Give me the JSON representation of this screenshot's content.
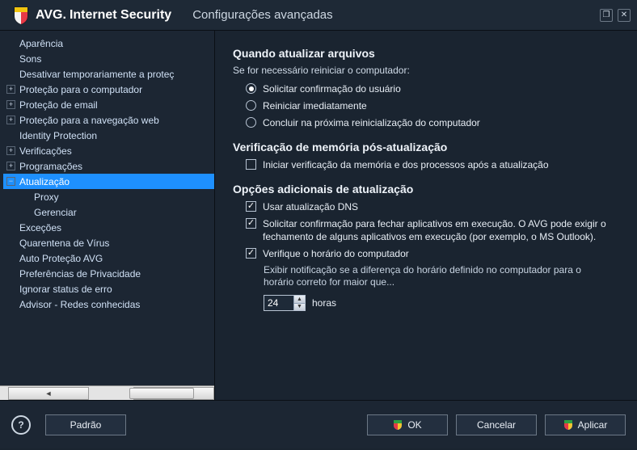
{
  "titlebar": {
    "brand_bold": "AVG.",
    "brand_product": "Internet Security",
    "subtitle": "Configurações avançadas"
  },
  "sidebar": {
    "items": [
      {
        "label": "Aparência",
        "exp": "",
        "level": 0,
        "selected": false
      },
      {
        "label": "Sons",
        "exp": "",
        "level": 0,
        "selected": false
      },
      {
        "label": "Desativar temporariamente a proteç",
        "exp": "",
        "level": 0,
        "selected": false
      },
      {
        "label": "Proteção para o computador",
        "exp": "+",
        "level": 0,
        "selected": false
      },
      {
        "label": "Proteção de email",
        "exp": "+",
        "level": 0,
        "selected": false
      },
      {
        "label": "Proteção para a navegação web",
        "exp": "+",
        "level": 0,
        "selected": false
      },
      {
        "label": "Identity Protection",
        "exp": "",
        "level": 0,
        "selected": false
      },
      {
        "label": "Verificações",
        "exp": "+",
        "level": 0,
        "selected": false
      },
      {
        "label": "Programações",
        "exp": "+",
        "level": 0,
        "selected": false
      },
      {
        "label": "Atualização",
        "exp": "−",
        "level": 0,
        "selected": true
      },
      {
        "label": "Proxy",
        "exp": "",
        "level": 1,
        "selected": false
      },
      {
        "label": "Gerenciar",
        "exp": "",
        "level": 1,
        "selected": false
      },
      {
        "label": "Exceções",
        "exp": "",
        "level": 0,
        "selected": false
      },
      {
        "label": "Quarentena de Vírus",
        "exp": "",
        "level": 0,
        "selected": false
      },
      {
        "label": "Auto Proteção AVG",
        "exp": "",
        "level": 0,
        "selected": false
      },
      {
        "label": "Preferências de Privacidade",
        "exp": "",
        "level": 0,
        "selected": false
      },
      {
        "label": "Ignorar status de erro",
        "exp": "",
        "level": 0,
        "selected": false
      },
      {
        "label": "Advisor - Redes conhecidas",
        "exp": "",
        "level": 0,
        "selected": false
      }
    ]
  },
  "content": {
    "section1_h": "Quando atualizar arquivos",
    "section1_sub": "Se for necessário reiniciar o computador:",
    "radios": [
      {
        "label": "Solicitar confirmação do usuário",
        "checked": true
      },
      {
        "label": "Reiniciar imediatamente",
        "checked": false
      },
      {
        "label": "Concluir na próxima reinicialização do computador",
        "checked": false
      }
    ],
    "section2_h": "Verificação de memória pós-atualização",
    "check_mem": {
      "label": "Iniciar verificação da memória e dos processos após a atualização",
      "checked": false
    },
    "section3_h": "Opções adicionais de atualização",
    "check_dns": {
      "label": "Usar atualização DNS",
      "checked": true
    },
    "check_close": {
      "label": "Solicitar confirmação para fechar aplicativos em execução. O AVG pode exigir o fechamento de alguns aplicativos em execução (por exemplo, o MS Outlook).",
      "checked": true
    },
    "check_time": {
      "label": "Verifique o horário do computador",
      "checked": true
    },
    "time_desc": "Exibir notificação se a diferença do horário definido no computador para o horário correto for maior que...",
    "time_value": "24",
    "time_unit": "horas"
  },
  "footer": {
    "default": "Padrão",
    "ok": "OK",
    "cancel": "Cancelar",
    "apply": "Aplicar"
  }
}
